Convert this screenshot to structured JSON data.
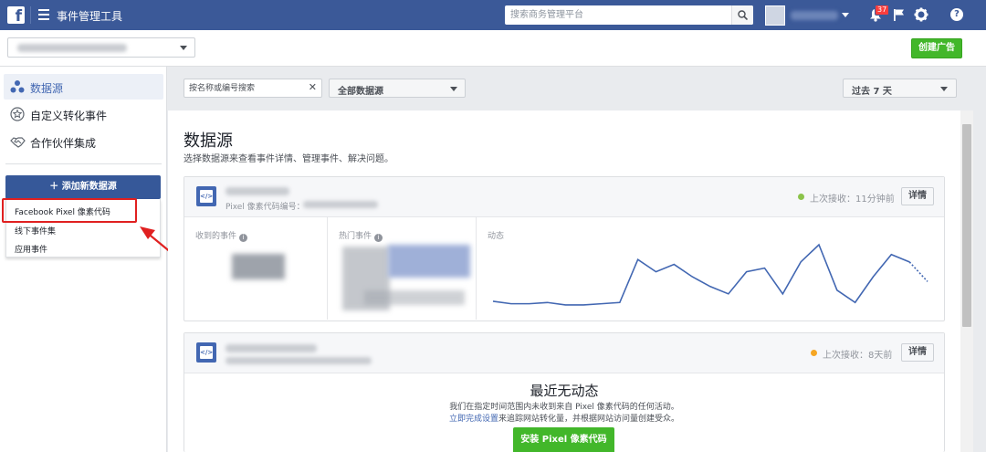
{
  "topbar": {
    "logo_letter": "f",
    "app_title": "事件管理工具",
    "search_placeholder": "搜索商务管理平台",
    "notification_count": "37",
    "help_label": "?"
  },
  "subheader": {
    "create_ad_label": "创建广告"
  },
  "sidebar": {
    "items": [
      {
        "label": "数据源",
        "icon": "data-sources-icon",
        "active": true
      },
      {
        "label": "自定义转化事件",
        "icon": "star-icon",
        "active": false
      },
      {
        "label": "合作伙伴集成",
        "icon": "handshake-icon",
        "active": false
      }
    ],
    "add_source_label": "＋  添加新数据源",
    "add_source_menu": [
      "Facebook Pixel 像素代码",
      "线下事件集",
      "应用事件"
    ]
  },
  "filters": {
    "search_placeholder": "按名称或编号搜索",
    "clear_label": "✕",
    "source_filter": "全部数据源",
    "date_filter": "过去 7 天"
  },
  "main": {
    "title": "数据源",
    "subtitle": "选择数据源来查看事件详情、管理事件、解决问题。",
    "cards": [
      {
        "pixel_id_label": "Pixel 像素代码编号：",
        "status_text": "上次接收：11分钟前",
        "status_color": "#8bc34a",
        "detail_label": "详情",
        "metric_received_label": "收到的事件",
        "metric_top_label": "热门事件",
        "metric_activity_label": "动态",
        "info_label": "i",
        "activity_series": [
          6,
          4,
          4,
          5,
          3,
          3,
          4,
          5,
          40,
          30,
          36,
          26,
          18,
          12,
          30,
          33,
          12,
          38,
          52,
          15,
          5,
          26,
          44,
          38,
          22
        ]
      },
      {
        "status_text": "上次接收：8天前",
        "status_color": "#f5a623",
        "detail_label": "详情",
        "empty_title": "最近无动态",
        "empty_line1": "我们在指定时间范围内未收到来自 Pixel 像素代码的任何活动。",
        "empty_link": "立即完成设置",
        "empty_line2": "来追踪网站转化量，并根据网站访问量创建受众。",
        "install_label": "安装 Pixel 像素代码"
      }
    ]
  },
  "colors": {
    "brand_blue": "#3b5998",
    "link_blue": "#4267b2",
    "green": "#42b72a",
    "highlight_red": "#e02020"
  }
}
